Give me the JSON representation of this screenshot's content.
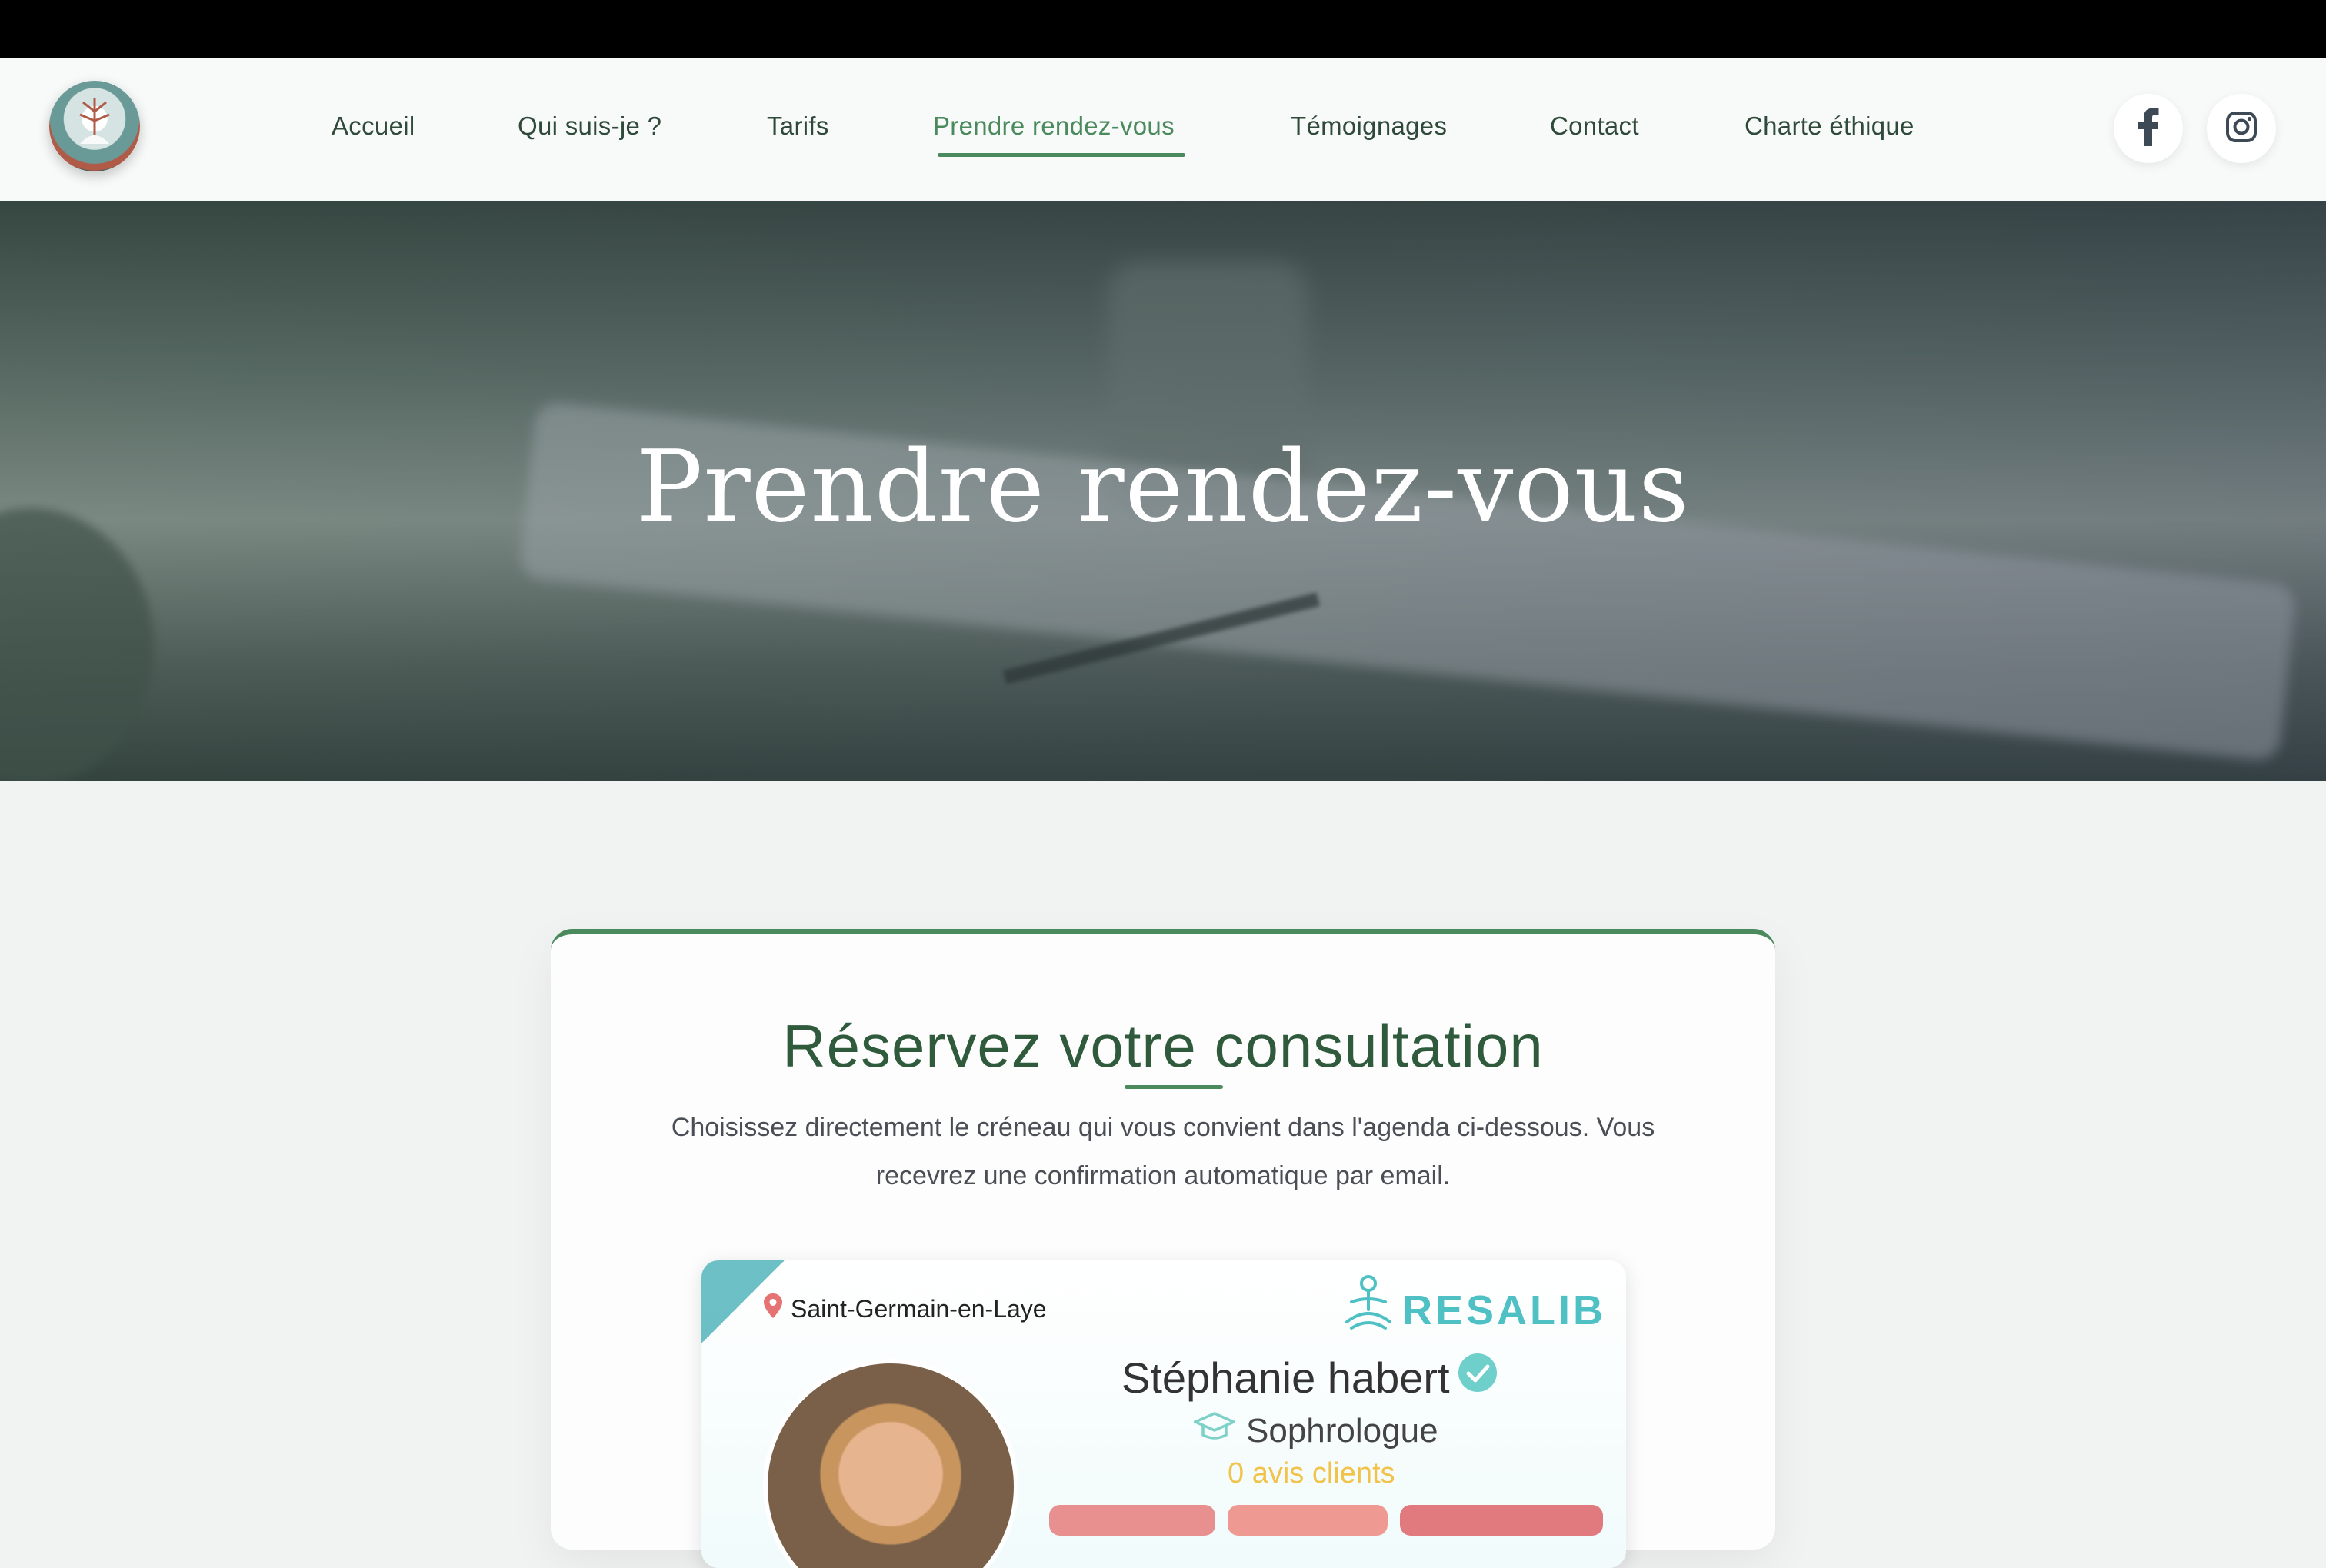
{
  "nav": {
    "items": [
      {
        "label": "Accueil"
      },
      {
        "label": "Qui suis-je ?"
      },
      {
        "label": "Tarifs"
      },
      {
        "label": "Prendre rendez-vous",
        "active": true
      },
      {
        "label": "Témoignages"
      },
      {
        "label": "Contact"
      },
      {
        "label": "Charte éthique"
      }
    ],
    "social": [
      {
        "name": "facebook-icon"
      },
      {
        "name": "instagram-icon"
      }
    ]
  },
  "hero": {
    "title": "Prendre rendez-vous"
  },
  "booking": {
    "title": "Réservez votre consultation",
    "description": "Choisissez directement le créneau qui vous convient dans l'agenda ci-dessous. Vous recevrez une confirmation automatique par email."
  },
  "widget": {
    "location": "Saint-Germain-en-Laye",
    "brand": "RESALIB",
    "practitioner_name": "Stéphanie habert",
    "role": "Sophrologue",
    "reviews": "0 avis clients"
  },
  "colors": {
    "accent": "#4a8a5d",
    "heading": "#2f5a3c",
    "resalib": "#4fc1c5",
    "reviews": "#f2c34a"
  }
}
